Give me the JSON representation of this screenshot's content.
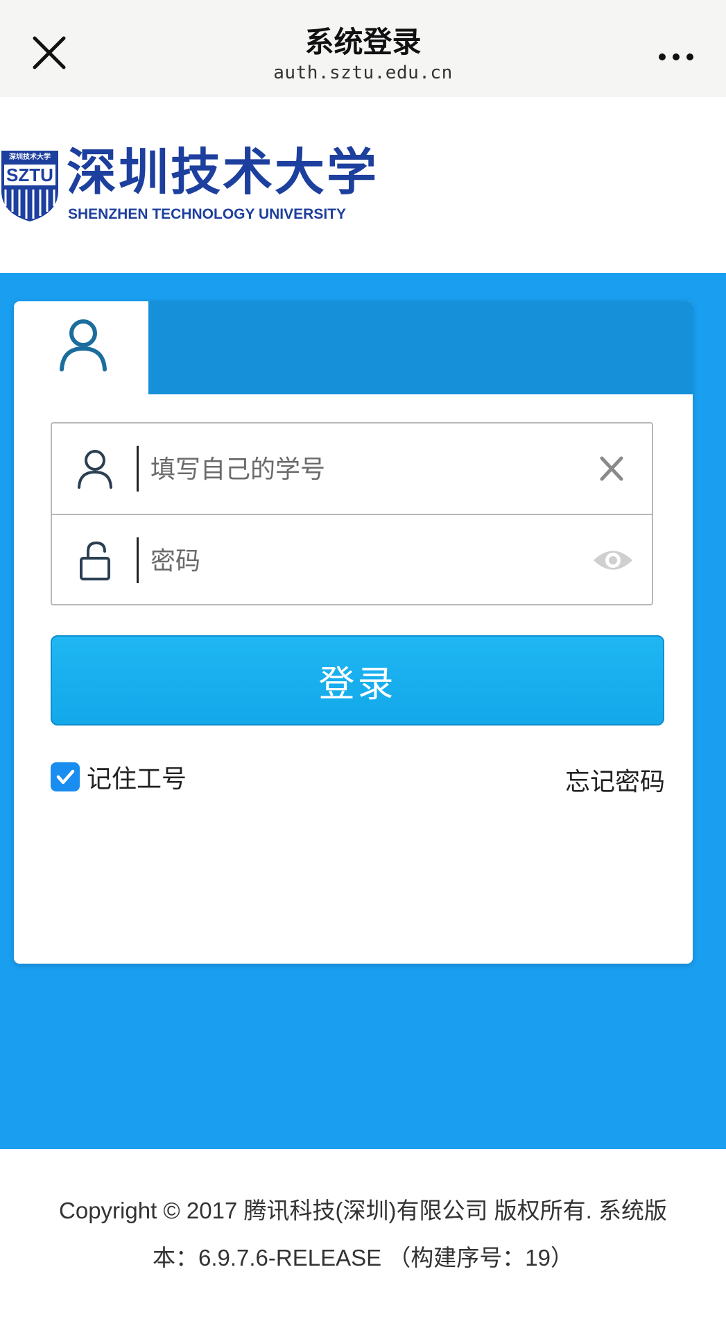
{
  "nav": {
    "title": "系统登录",
    "url": "auth.sztu.edu.cn",
    "close_icon": "close-icon",
    "more_icon": "more-icon"
  },
  "logo": {
    "cn": "深圳技术大学",
    "en": "SHENZHEN TECHNOLOGY UNIVERSITY",
    "badge_text": "SZTU",
    "badge_top": "深圳技术大学"
  },
  "login_form": {
    "tab_icon": "user-icon",
    "username": {
      "value": "",
      "placeholder": "填写自己的学号",
      "icon": "user-icon",
      "action_icon": "clear-icon"
    },
    "password": {
      "value": "",
      "placeholder": "密码",
      "icon": "unlock-icon",
      "action_icon": "eye-icon"
    },
    "submit_label": "登录",
    "remember_label": "记住工号",
    "remember_checked": true,
    "forgot_label": "忘记密码"
  },
  "footer": {
    "line1": "Copyright © 2017 腾讯科技(深圳)有限公司 版权所有. 系统版",
    "line2": "本：6.9.7.6-RELEASE （构建序号：19）"
  },
  "colors": {
    "brand_blue": "#1d3f9e",
    "page_blue": "#1a9ef0",
    "header_blue": "#1690d8",
    "button_blue": "#1fb6f3",
    "checkbox_blue": "#1a8df0"
  }
}
